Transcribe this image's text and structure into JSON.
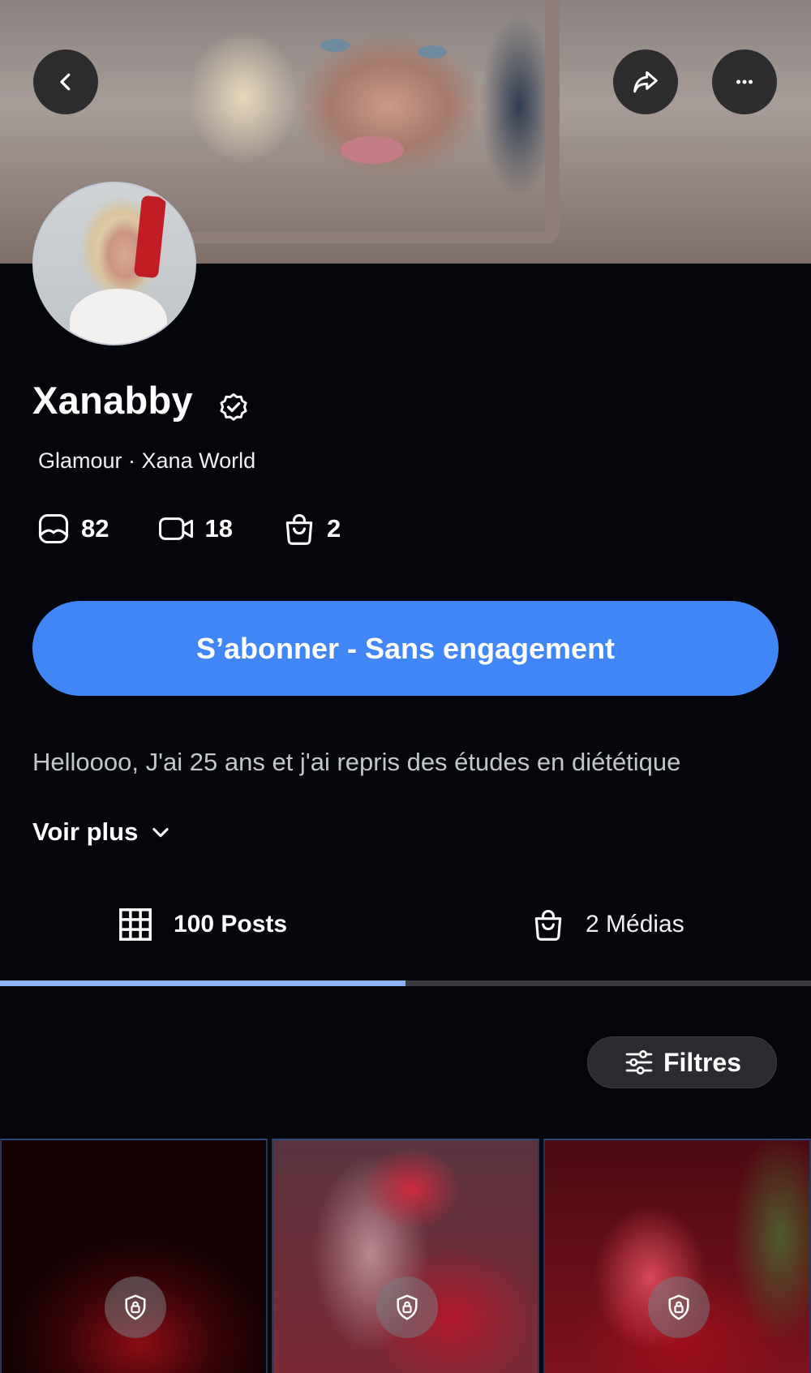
{
  "profile": {
    "name": "Xanabby",
    "subtitle": "Glamour · Xana World"
  },
  "stats": {
    "photos": "82",
    "videos": "18",
    "items": "2"
  },
  "subscribe_label": "S’abonner - Sans engagement",
  "bio": {
    "text": "Helloooo, J'ai 25 ans et j'ai repris des études en diététique",
    "more_label": "Voir plus"
  },
  "tabs": {
    "posts_label": "100 Posts",
    "medias_label": "2 Médias",
    "active": "posts"
  },
  "filters_label": "Filtres",
  "colors": {
    "background": "#05060b",
    "accent": "#4186f7",
    "tab_indicator": "#8ab3f7"
  },
  "icons": {
    "back": "chevron-left-icon",
    "share": "share-arrow-icon",
    "more": "more-dots-icon",
    "verified": "verified-badge-icon",
    "photos": "photo-icon",
    "videos": "video-camera-icon",
    "items": "shopping-bag-icon",
    "posts_tab": "grid-icon",
    "medias_tab": "shopping-bag-icon",
    "filters": "sliders-icon",
    "locked_post": "lock-shield-icon"
  }
}
